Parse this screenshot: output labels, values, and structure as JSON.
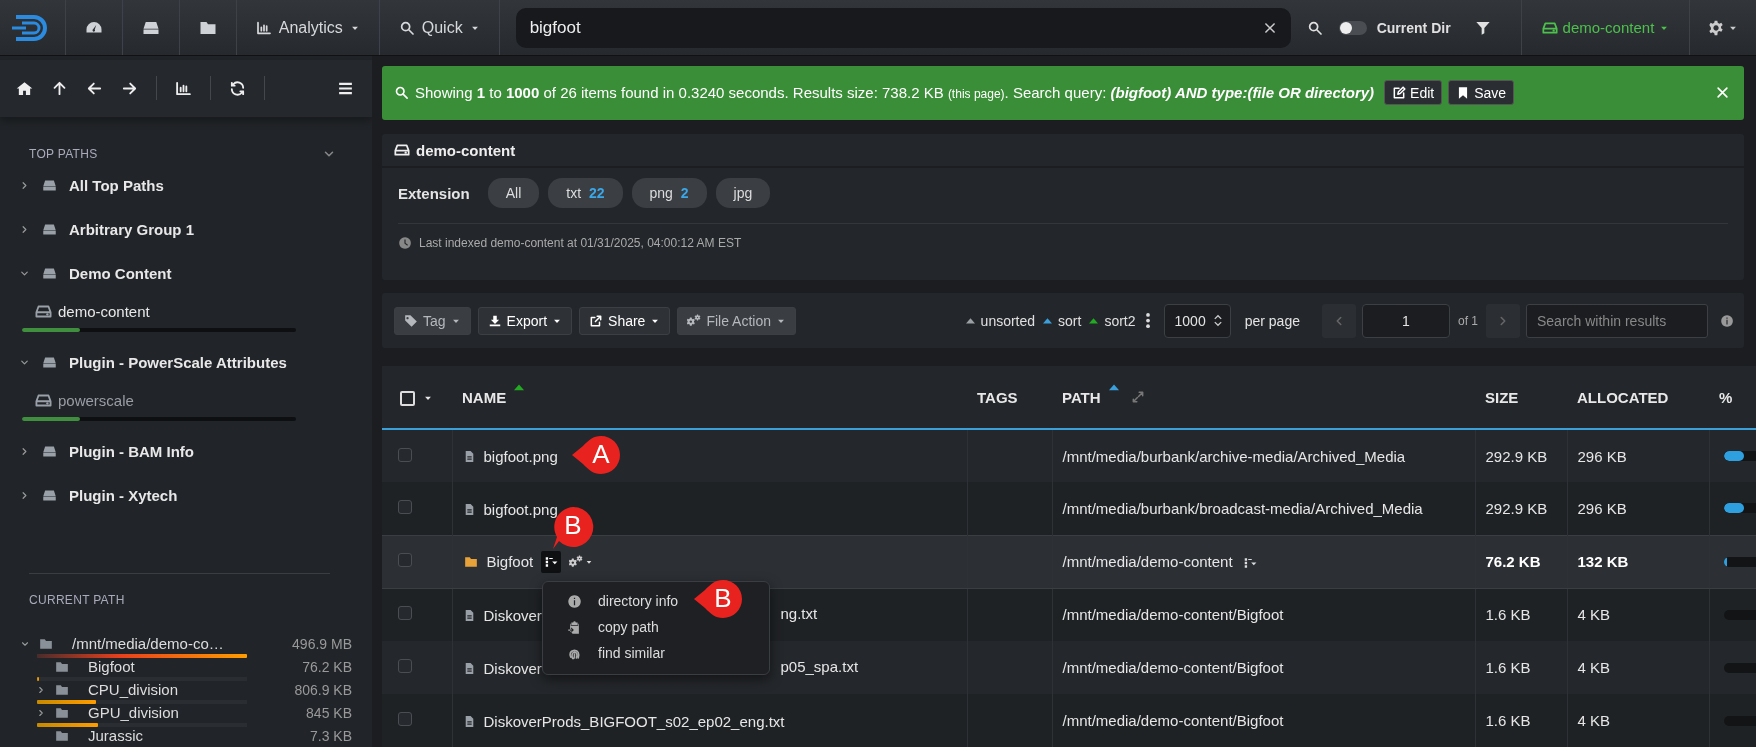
{
  "topbar": {
    "menus": [
      {
        "label": "Analytics"
      },
      {
        "label": "Quick"
      }
    ],
    "search": {
      "value": "bigfoot"
    },
    "current_dir": {
      "label": "Current Dir",
      "on": false
    },
    "index": {
      "label": "demo-content"
    }
  },
  "sidebar": {
    "top_paths": {
      "title": "TOP PATHS",
      "items": [
        {
          "label": "All Top Paths",
          "expanded": false
        },
        {
          "label": "Arbitrary Group 1",
          "expanded": false
        },
        {
          "label": "Demo Content",
          "expanded": true,
          "children": [
            {
              "label": "demo-content",
              "selected": true,
              "level": 0.21
            }
          ]
        },
        {
          "label": "Plugin - PowerScale Attributes",
          "expanded": true,
          "children": [
            {
              "label": "powerscale",
              "selected": false,
              "level": 0.21
            }
          ]
        },
        {
          "label": "Plugin - BAM Info",
          "expanded": false
        },
        {
          "label": "Plugin - Xytech",
          "expanded": false
        }
      ]
    },
    "current_path": {
      "title": "CURRENT PATH",
      "tree": {
        "label": "/mnt/media/demo-co…",
        "size": "496.9 MB",
        "expanded": true,
        "level": 1,
        "children": [
          {
            "label": "Bigfoot",
            "size": "76.2 KB",
            "expandable": false,
            "level": 0.01
          },
          {
            "label": "CPU_division",
            "size": "806.9 KB",
            "expandable": true,
            "level": 0.28
          },
          {
            "label": "GPU_division",
            "size": "845 KB",
            "expandable": true,
            "level": 0.29
          },
          {
            "label": "Jurassic",
            "size": "7.3 KB",
            "expandable": false
          }
        ]
      }
    }
  },
  "main": {
    "banner": {
      "segments": [
        {
          "kind": "normal",
          "text": "Showing **1** to **1000** of 26 items found in 0.3240 seconds. Results size: 738.2 KB "
        },
        {
          "kind": "small",
          "text": "(this page)"
        },
        {
          "kind": "normal",
          "text": ". Search query: "
        },
        {
          "kind": "query",
          "text": "(bigfoot) AND type:(file OR directory)"
        }
      ],
      "buttons": [
        {
          "label": "Edit"
        },
        {
          "label": "Save"
        }
      ]
    },
    "index_header": {
      "label": "demo-content"
    },
    "filters": {
      "label": "Extension",
      "chips": [
        {
          "label": "All"
        },
        {
          "label": "txt",
          "count": "22"
        },
        {
          "label": "png",
          "count": "2"
        },
        {
          "label": "jpg"
        }
      ],
      "note": "Last indexed demo-content at 01/31/2025, 04:00:12 AM EST"
    },
    "toolbar": {
      "actions": [
        {
          "label": "Tag",
          "disabled": true
        },
        {
          "label": "Export",
          "disabled": false
        },
        {
          "label": "Share",
          "disabled": false
        },
        {
          "label": "File Action",
          "disabled": true
        }
      ],
      "sorts": [
        {
          "label": "unsorted",
          "color": "#9aa0a6"
        },
        {
          "label": "sort",
          "color": "#3aa0dc"
        },
        {
          "label": "sort2",
          "color": "#22aa22"
        }
      ],
      "per_page": {
        "value": "1000",
        "label": "per page"
      },
      "pagination": {
        "page": "1",
        "of": "of 1"
      },
      "search": {
        "placeholder": "Search within results"
      }
    },
    "table": {
      "select_all": {
        "checked": false
      },
      "columns": [
        {
          "label": "NAME",
          "color": "#22aa22"
        },
        {
          "label": "TAGS"
        },
        {
          "label": "PATH",
          "color": "#3aa0dc"
        },
        {
          "label": "SIZE"
        },
        {
          "label": "ALLOCATED"
        },
        {
          "label": "%"
        }
      ],
      "rows": [
        {
          "kind": "file",
          "name": "bigfoot.png",
          "annotation": "A",
          "path": "/mnt/media/burbank/archive-media/Archived_Media",
          "size": "292.9 KB",
          "allocated": "296 KB",
          "level": 0.5,
          "checked": false,
          "highlighted": false
        },
        {
          "kind": "file",
          "name": "bigfoot.png",
          "path": "/mnt/media/burbank/broadcast-media/Archived_Media",
          "size": "292.9 KB",
          "allocated": "296 KB",
          "level": 0.5,
          "checked": false,
          "highlighted": false
        },
        {
          "kind": "folder",
          "name": "Bigfoot",
          "actions_annotation": "B",
          "path": "/mnt/media/demo-content",
          "size": "76.2 KB",
          "allocated": "132 KB",
          "level": 0.08,
          "checked": false,
          "highlighted": true
        },
        {
          "kind": "file",
          "name": "Diskover",
          "name_tail": "ng.txt",
          "path": "/mnt/media/demo-content/Bigfoot",
          "size": "1.6 KB",
          "allocated": "4 KB",
          "level": 0,
          "checked": false,
          "highlighted": false
        },
        {
          "kind": "file",
          "name": "Diskover",
          "name_tail": "p05_spa.txt",
          "path": "/mnt/media/demo-content/Bigfoot",
          "size": "1.6 KB",
          "allocated": "4 KB",
          "level": 0,
          "checked": false,
          "highlighted": false
        },
        {
          "kind": "file",
          "name": "DiskoverProds_BIGFOOT_s02_ep02_eng.txt",
          "path": "/mnt/media/demo-content/Bigfoot",
          "size": "1.6 KB",
          "allocated": "4 KB",
          "level": 0,
          "checked": false,
          "highlighted": false
        }
      ],
      "row_menu": {
        "items": [
          {
            "label": "directory info",
            "annotation": "B"
          },
          {
            "label": "copy path"
          },
          {
            "label": "find similar"
          }
        ]
      }
    }
  }
}
